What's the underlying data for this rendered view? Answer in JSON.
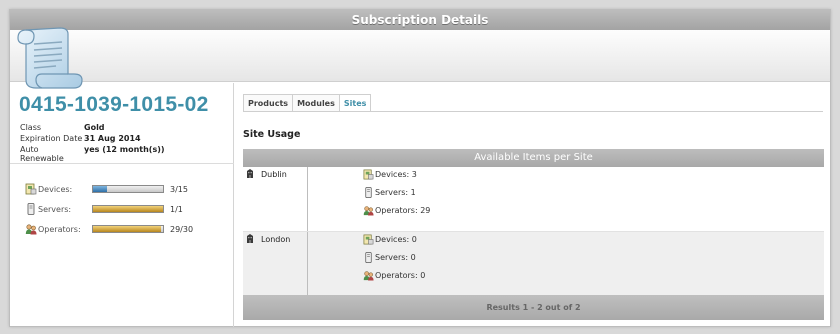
{
  "window": {
    "title": "Subscription Details"
  },
  "subscription": {
    "id": "0415-1039-1015-02",
    "info": [
      {
        "label": "Class",
        "value": "Gold"
      },
      {
        "label": "Expiration Date",
        "value": "31 Aug 2014"
      },
      {
        "label": "Auto Renewable",
        "value": "yes (12 month(s))"
      }
    ]
  },
  "usage": [
    {
      "icon": "devices-icon",
      "label": "Devices:",
      "count": "3/15",
      "fill": 0.2,
      "color": "blue"
    },
    {
      "icon": "servers-icon",
      "label": "Servers:",
      "count": "1/1",
      "fill": 1.0,
      "color": "gold"
    },
    {
      "icon": "operators-icon",
      "label": "Operators:",
      "count": "29/30",
      "fill": 0.967,
      "color": "gold"
    }
  ],
  "tabs": [
    {
      "label": "Products",
      "active": false
    },
    {
      "label": "Modules",
      "active": false
    },
    {
      "label": "Sites",
      "active": true
    }
  ],
  "section_title": "Site Usage",
  "grid": {
    "header": "Available Items per Site",
    "rows": [
      {
        "site": "Dublin",
        "items": [
          {
            "icon": "devices-icon",
            "text": "Devices: 3"
          },
          {
            "icon": "servers-icon",
            "text": "Servers: 1"
          },
          {
            "icon": "operators-icon",
            "text": "Operators: 29"
          }
        ]
      },
      {
        "site": "London",
        "items": [
          {
            "icon": "devices-icon",
            "text": "Devices: 0"
          },
          {
            "icon": "servers-icon",
            "text": "Servers: 0"
          },
          {
            "icon": "operators-icon",
            "text": "Operators: 0"
          }
        ]
      }
    ],
    "footer": "Results 1 - 2 out of 2"
  },
  "colors": {
    "accent": "#3f8fa8",
    "header_gray": "#a8a8a8"
  }
}
